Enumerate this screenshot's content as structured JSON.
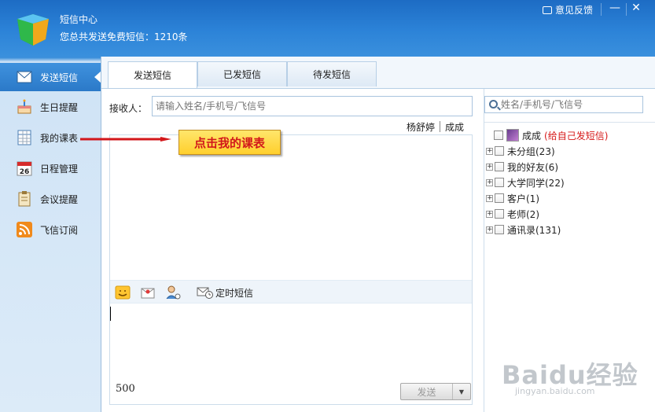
{
  "window": {
    "title": "短信中心",
    "subtitle": "您总共发送免费短信：1210条",
    "feedback_label": "意见反馈",
    "minimize_glyph": "—",
    "close_glyph": "✕"
  },
  "sidebar": {
    "items": [
      {
        "label": "发送短信",
        "icon": "sms-send-icon"
      },
      {
        "label": "生日提醒",
        "icon": "birthday-cake-icon"
      },
      {
        "label": "我的课表",
        "icon": "timetable-icon"
      },
      {
        "label": "日程管理",
        "icon": "calendar-icon"
      },
      {
        "label": "会议提醒",
        "icon": "clipboard-icon"
      },
      {
        "label": "飞信订阅",
        "icon": "rss-icon"
      }
    ]
  },
  "tabs": [
    {
      "label": "发送短信"
    },
    {
      "label": "已发短信"
    },
    {
      "label": "待发短信"
    }
  ],
  "compose": {
    "recipient_label": "接收人：",
    "recipient_placeholder": "请输入姓名/手机号/飞信号",
    "recipients": [
      "杨舒婷",
      "成成"
    ],
    "timed_sms_label": "定时短信",
    "char_count": "500",
    "send_label": "发送",
    "dropdown_glyph": "▼"
  },
  "contacts": {
    "search_placeholder": "姓名/手机号/飞信号",
    "self": {
      "name": "成成",
      "note": "(给自己发短信)"
    },
    "groups": [
      {
        "label": "未分组(23)"
      },
      {
        "label": "我的好友(6)"
      },
      {
        "label": "大学同学(22)"
      },
      {
        "label": "客户(1)"
      },
      {
        "label": "老师(2)"
      },
      {
        "label": "通讯录(131)"
      }
    ]
  },
  "annotation": {
    "text": "点击我的课表"
  },
  "watermark": {
    "brand": "Baidu经验",
    "url": "jingyan.baidu.com"
  },
  "colors": {
    "accent": "#2b79c8",
    "annotation_red": "#d2171b",
    "annotation_fill": "#ffd84a"
  }
}
